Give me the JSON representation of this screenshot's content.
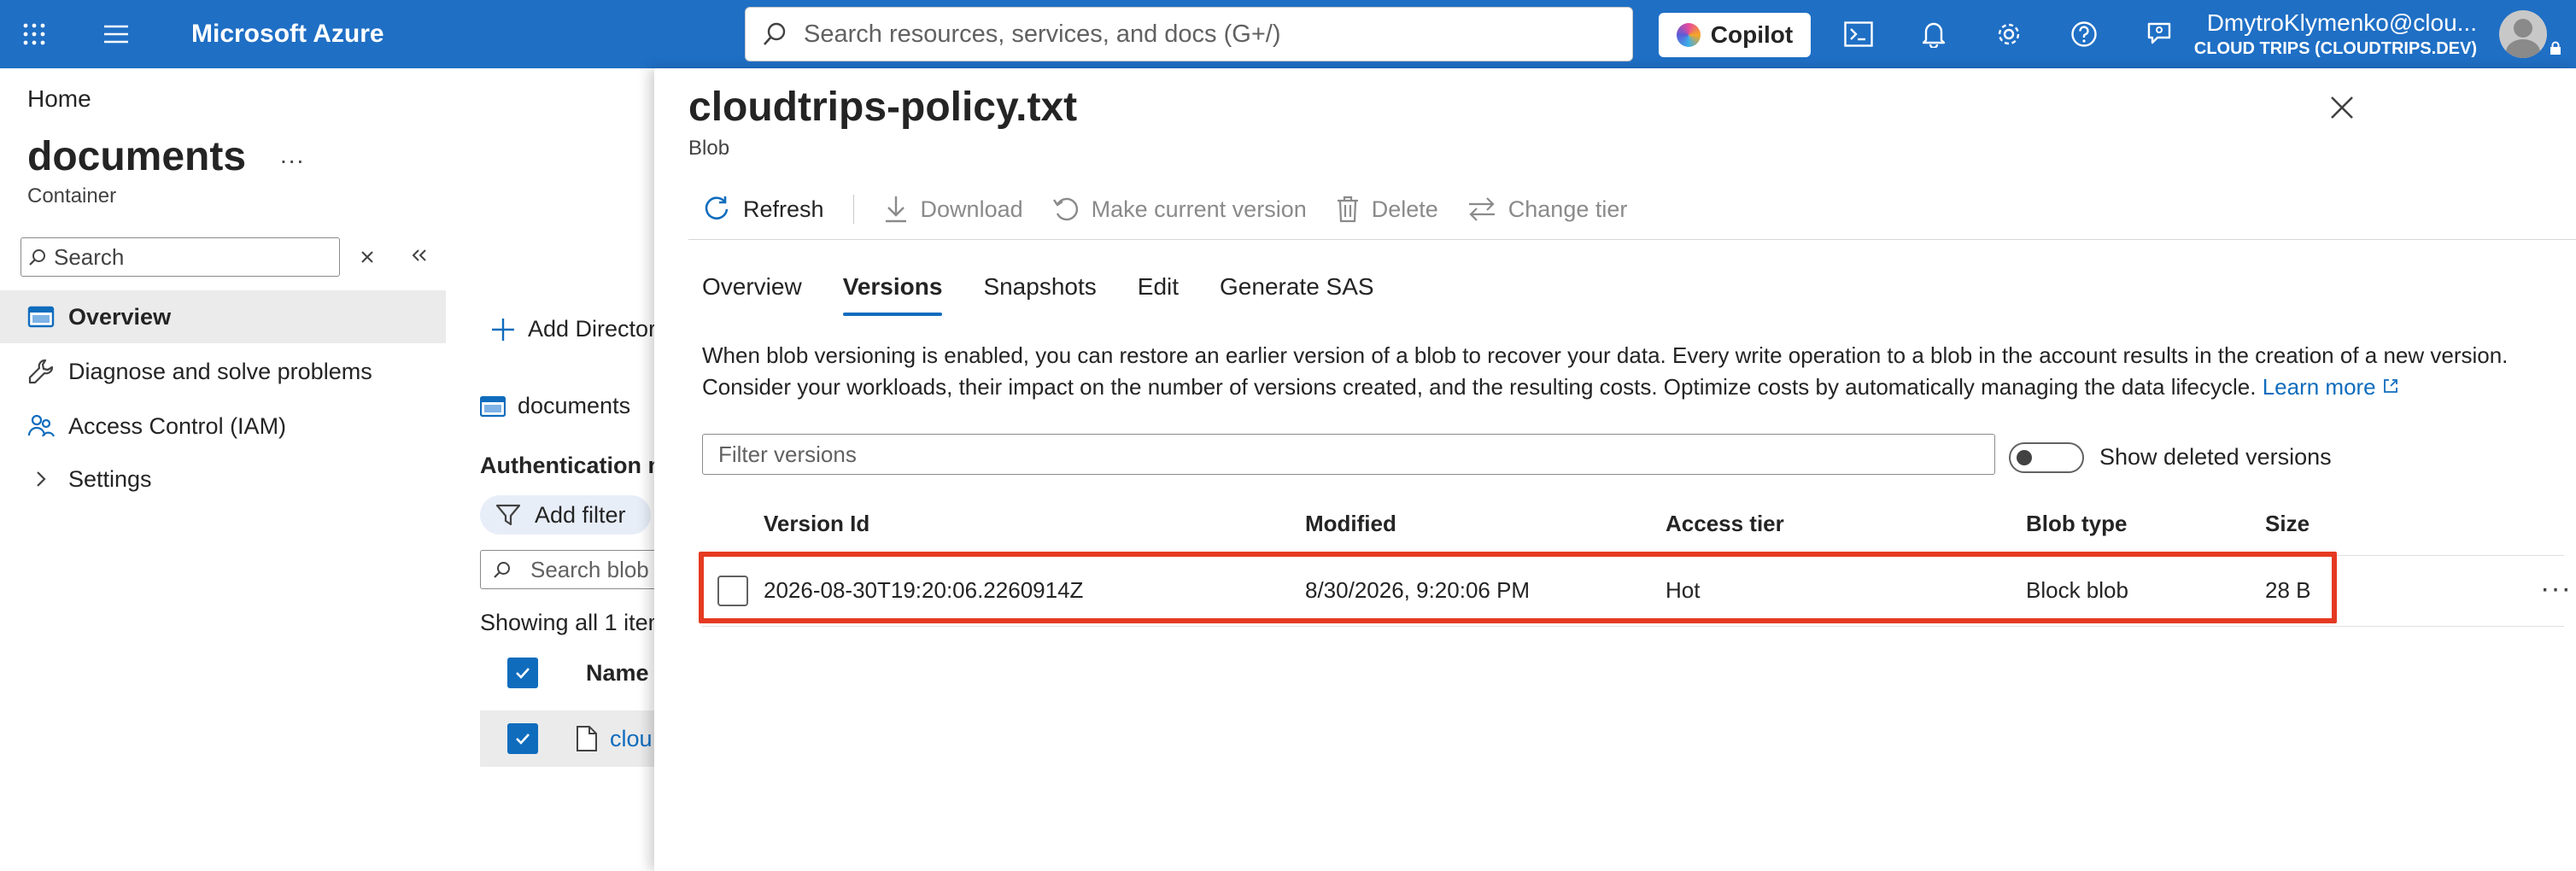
{
  "topbar": {
    "brand": "Microsoft Azure",
    "search_placeholder": "Search resources, services, and docs (G+/)",
    "copilot_label": "Copilot",
    "user_name": "DmytroKlymenko@clou...",
    "tenant": "CLOUD TRIPS (CLOUDTRIPS.DEV)",
    "icons": [
      "grid-icon",
      "menu-icon",
      "cloud-shell-icon",
      "bell-icon",
      "gear-icon",
      "help-icon",
      "feedback-icon"
    ]
  },
  "left": {
    "breadcrumb_home": "Home",
    "title": "documents",
    "more": "...",
    "subtitle": "Container",
    "search_placeholder": "Search",
    "nav": [
      {
        "label": "Overview",
        "icon": "container-icon",
        "active": true
      },
      {
        "label": "Diagnose and solve problems",
        "icon": "wrench-icon"
      },
      {
        "label": "Access Control (IAM)",
        "icon": "people-icon"
      },
      {
        "label": "Settings",
        "icon": "chevron-right-icon"
      }
    ]
  },
  "middle": {
    "add_directory": "Add Director",
    "crumb": "documents",
    "auth": "Authentication m",
    "add_filter": "Add filter",
    "search_placeholder": "Search blob",
    "showing": "Showing all 1 item",
    "col_name": "Name",
    "row_name": "clou"
  },
  "panel": {
    "title": "cloudtrips-policy.txt",
    "subtitle": "Blob",
    "toolbar": {
      "refresh": "Refresh",
      "download": "Download",
      "make_current": "Make current version",
      "delete": "Delete",
      "change_tier": "Change tier"
    },
    "tabs": [
      "Overview",
      "Versions",
      "Snapshots",
      "Edit",
      "Generate SAS"
    ],
    "active_tab": "Versions",
    "description_line1": "When blob versioning is enabled, you can restore an earlier version of a blob to recover your data. Every write operation to a blob in the account results in the creation of a new version.",
    "description_line2": "Consider your workloads, their impact on the number of versions created, and the resulting costs. Optimize costs by automatically managing the data lifecycle.",
    "learn_more": "Learn more",
    "filter_placeholder": "Filter versions",
    "show_deleted": "Show deleted versions",
    "columns": {
      "version_id": "Version Id",
      "modified": "Modified",
      "access_tier": "Access tier",
      "blob_type": "Blob type",
      "size": "Size"
    },
    "rows": [
      {
        "version_id": "2026-08-30T19:20:06.2260914Z",
        "modified": "8/30/2026, 9:20:06 PM",
        "access_tier": "Hot",
        "blob_type": "Block blob",
        "size": "28 B",
        "more": "···"
      }
    ]
  },
  "colors": {
    "topbar": "#1f6fc5",
    "accent": "#0f6cbd",
    "highlight": "#e53a22"
  }
}
